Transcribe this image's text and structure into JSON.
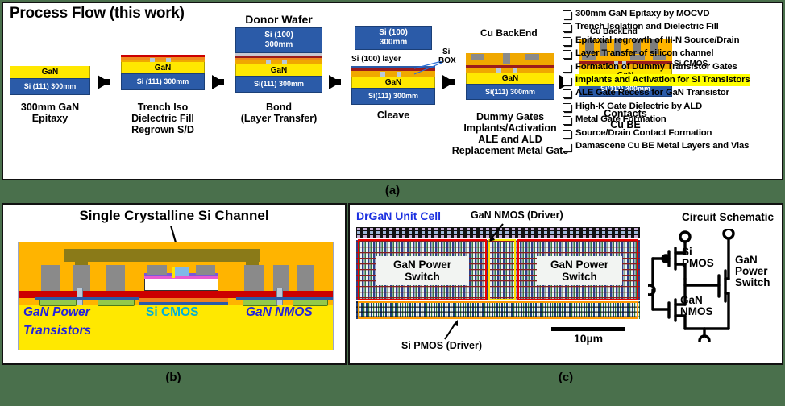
{
  "figure": {
    "captions": {
      "a": "(a)",
      "b": "(b)",
      "c": "(c)"
    },
    "background_color": "#4a704c"
  },
  "panel_a": {
    "title": "Process Flow (this work)",
    "stages": [
      {
        "id": "epitaxy",
        "top_label": "",
        "caption": "300mm GaN\nEpitaxy",
        "caption_lines": [
          "300mm GaN",
          "Epitaxy"
        ],
        "layers": [
          {
            "label": "GaN",
            "color": "#ffe800"
          },
          {
            "label": "Si (111) 300mm",
            "color": "#2b5ba8"
          }
        ]
      },
      {
        "id": "trench-iso",
        "top_label": "",
        "caption_lines": [
          "Trench Iso",
          "Dielectric Fill",
          "Regrown S/D"
        ],
        "layers": [
          {
            "label": "GaN",
            "color": "#ffe800"
          },
          {
            "label": "Si (111) 300mm",
            "color": "#2b5ba8"
          }
        ]
      },
      {
        "id": "bond",
        "top_label": "Donor Wafer",
        "caption_lines": [
          "Bond",
          "(Layer Transfer)"
        ],
        "donor_lines": [
          "Si (100)",
          "300mm"
        ],
        "layers": [
          {
            "label": "GaN",
            "color": "#ffe800"
          },
          {
            "label": "Si(111) 300mm",
            "color": "#2b5ba8"
          }
        ]
      },
      {
        "id": "cleave",
        "top_label": "",
        "caption_lines": [
          "Cleave"
        ],
        "donor_lines": [
          "Si (100)",
          "300mm"
        ],
        "annotations": [
          "Si (100) layer",
          "Si",
          "BOX"
        ],
        "layers": [
          {
            "label": "GaN",
            "color": "#ffe800"
          },
          {
            "label": "Si(111) 300mm",
            "color": "#2b5ba8"
          }
        ]
      },
      {
        "id": "dummy-gates",
        "top_label": "",
        "caption_lines": [
          "Dummy Gates",
          "Implants/Activation",
          "ALE and ALD",
          "Replacement Metal Gate"
        ],
        "layers": [
          {
            "label": "GaN",
            "color": "#ffe800"
          },
          {
            "label": "Si(111) 300mm",
            "color": "#2b5ba8"
          }
        ]
      },
      {
        "id": "contacts",
        "top_label": "Cu BackEnd",
        "caption_lines": [
          "Contacts",
          "Cu BE"
        ],
        "annotations": [
          "Si CMOS"
        ],
        "layers": [
          {
            "label": "GaN",
            "color": "#ffe800"
          },
          {
            "label": "Si(111) 300mm",
            "color": "#2b5ba8"
          }
        ]
      }
    ],
    "checklist": {
      "items": [
        {
          "text": "300mm GaN Epitaxy by MOCVD",
          "highlighted": false
        },
        {
          "text": "Trench Isolation and Dielectric Fill",
          "highlighted": false
        },
        {
          "text": "Epitaxial regrowth of III-N Source/Drain",
          "highlighted": false
        },
        {
          "text": "Layer Transfer of silicon channel",
          "highlighted": false
        },
        {
          "text": "Formation of Dummy Transistor Gates",
          "highlighted": false
        },
        {
          "text": "Implants and Activation for Si Transistors",
          "highlighted": true
        },
        {
          "text": "ALE Gate Recess for GaN Transistor",
          "highlighted": false
        },
        {
          "text": "High-K Gate Dielectric by ALD",
          "highlighted": false
        },
        {
          "text": "Metal Gate Formation",
          "highlighted": false
        },
        {
          "text": "Source/Drain Contact Formation",
          "highlighted": false
        },
        {
          "text": "Damascene Cu BE Metal Layers and Vias",
          "highlighted": false
        }
      ],
      "highlight_color": "#ffff00"
    }
  },
  "panel_b": {
    "title": "Single Crystalline Si Channel",
    "labels": {
      "left_line1": "GaN Power",
      "left_line2": "Transistors",
      "center": "Si CMOS",
      "right": "GaN NMOS"
    },
    "colors": {
      "gan_yellow": "#ffe800",
      "label_blue": "#2222dd",
      "label_cyan": "#00b0d8"
    }
  },
  "panel_c": {
    "unit_cell_label": "DrGaN Unit Cell",
    "unit_cell_color": "#1a2fe0",
    "layout_blocks": [
      {
        "label_lines": [
          "GaN Power",
          "Switch"
        ],
        "box_color": "#ee0000"
      },
      {
        "label_lines": [
          "GaN Power",
          "Switch"
        ],
        "box_color": "#ee0000"
      }
    ],
    "annotations": {
      "gan_nmos": "GaN NMOS (Driver)",
      "si_pmos": "Si PMOS (Driver)"
    },
    "scale_bar": "10µm",
    "schematic": {
      "title": "Circuit Schematic",
      "si_pmos_lines": [
        "Si",
        "PMOS"
      ],
      "gan_nmos_lines": [
        "GaN",
        "NMOS"
      ],
      "gan_power_switch_lines": [
        "GaN",
        "Power",
        "Switch"
      ]
    }
  }
}
